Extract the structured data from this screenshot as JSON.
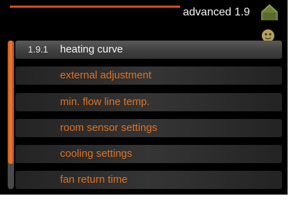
{
  "header": {
    "title": "advanced 1.9",
    "accent_color": "#d94f1c",
    "icon": "house-icon"
  },
  "back": {
    "icon": "back-arrow-icon"
  },
  "scrollbar": {
    "track_color": "#4a4a4a",
    "thumb_color": "#ee7a32"
  },
  "menu": {
    "selected_number": "1.9.1",
    "text_color": "#e0721f",
    "items": [
      {
        "label": "heating curve"
      },
      {
        "label": "external adjustment"
      },
      {
        "label": "min. flow line temp."
      },
      {
        "label": "room sensor settings"
      },
      {
        "label": "cooling settings"
      },
      {
        "label": "fan return time"
      }
    ]
  }
}
